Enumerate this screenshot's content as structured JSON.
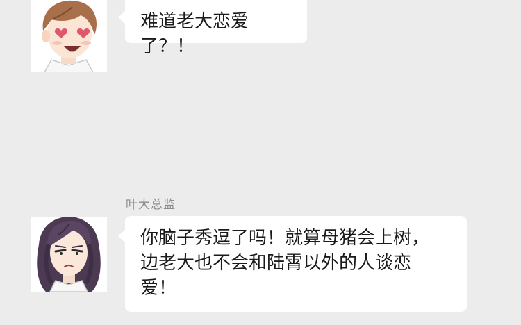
{
  "messages": [
    {
      "sender": "",
      "avatar_icon": "brown-haired-man-heart-eyes-avatar",
      "text_lines": [
        "难道老大恋爱了？！"
      ]
    },
    {
      "sender": "叶大总监",
      "avatar_icon": "purple-haired-woman-annoyed-avatar",
      "text_lines": [
        "你脑子秀逗了吗！就算母猪会上树，",
        "边老大也不会和陆霄以外的人谈恋",
        "爱！"
      ]
    }
  ],
  "colors": {
    "background": "#ececec",
    "bubble": "#ffffff",
    "sender_name": "#8c8c8c",
    "text": "#1a1a1a"
  }
}
